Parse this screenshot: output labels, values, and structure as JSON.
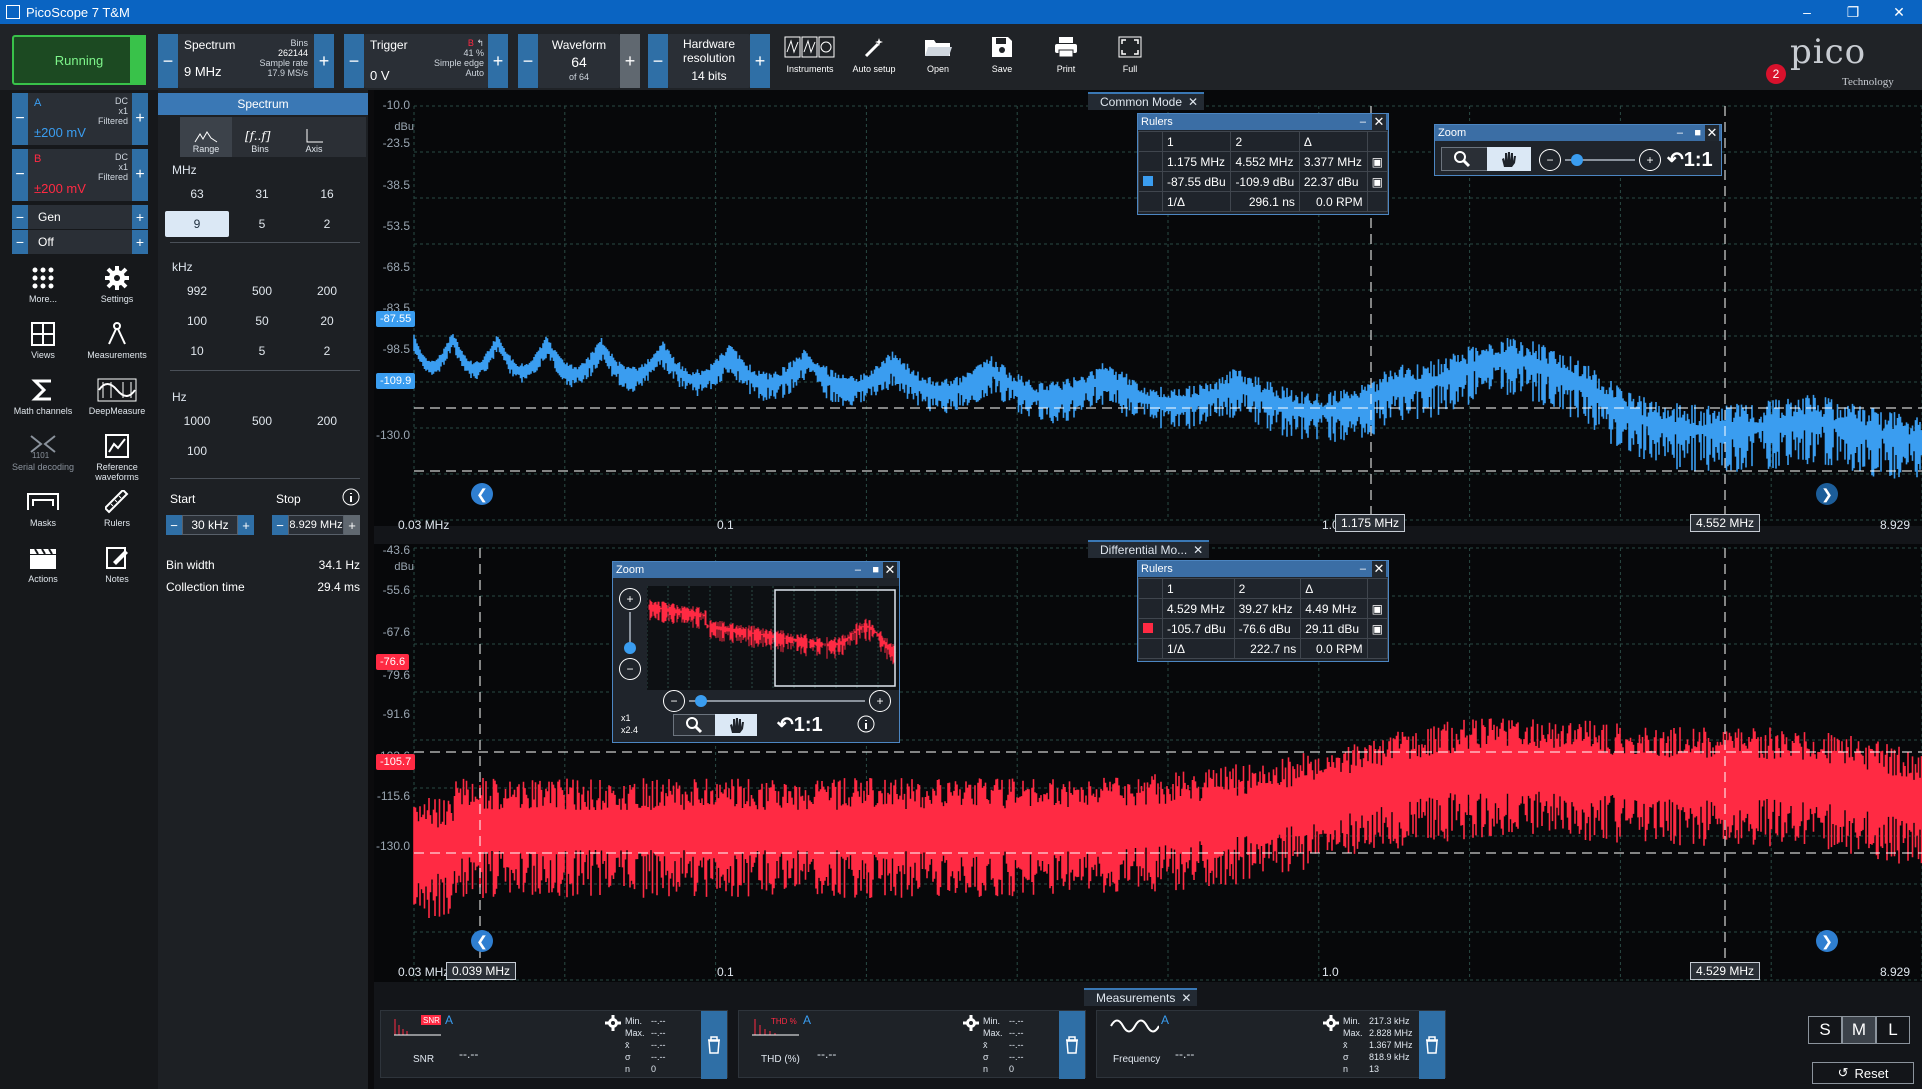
{
  "window": {
    "title": "PicoScope 7 T&M"
  },
  "toolbar": {
    "run_label": "Running",
    "spectrum": {
      "label": "Spectrum",
      "value": "9 MHz",
      "bins_label": "Bins",
      "bins_value": "262144",
      "sample_rate_label": "Sample rate",
      "sample_rate_value": "17.9 MS/s"
    },
    "trigger": {
      "label": "Trigger",
      "value": "0 V",
      "channel": "B",
      "percent": "41 %",
      "type": "Simple edge",
      "mode": "Auto"
    },
    "waveform": {
      "label": "Waveform",
      "value": "64",
      "of": "of 64"
    },
    "hw_res": {
      "label1": "Hardware",
      "label2": "resolution",
      "value": "14 bits"
    },
    "buttons": {
      "instruments": "Instruments",
      "autosetup": "Auto setup",
      "open": "Open",
      "save": "Save",
      "print": "Print",
      "full": "Full"
    },
    "logo_text": "pico",
    "logo_sub": "Technology",
    "notifications": "2"
  },
  "channels": [
    {
      "name": "A",
      "range": "±200 mV",
      "coupling": "DC",
      "probe": "x1",
      "filter": "Filtered",
      "color": "#3a9df0"
    },
    {
      "name": "B",
      "range": "±200 mV",
      "coupling": "DC",
      "probe": "x1",
      "filter": "Filtered",
      "color": "#ff2a43"
    }
  ],
  "gen": {
    "label": "Gen",
    "state": "Off"
  },
  "tools": {
    "more": "More...",
    "settings": "Settings",
    "views": "Views",
    "measurements": "Measurements",
    "math": "Math channels",
    "deep": "DeepMeasure",
    "serial": "Serial decoding",
    "reference": "Reference waveforms",
    "masks": "Masks",
    "rulers": "Rulers",
    "actions": "Actions",
    "notes": "Notes"
  },
  "spectrum_panel": {
    "title": "Spectrum",
    "tabs": [
      "Range",
      "Bins",
      "Axis"
    ],
    "mhz_title": "MHz",
    "mhz": [
      "63",
      "31",
      "16",
      "9",
      "5",
      "2"
    ],
    "khz_title": "kHz",
    "khz": [
      "992",
      "500",
      "200",
      "100",
      "50",
      "20",
      "10",
      "5",
      "2"
    ],
    "hz_title": "Hz",
    "hz": [
      "1000",
      "500",
      "200",
      "100"
    ],
    "start_label": "Start",
    "stop_label": "Stop",
    "start_value": "30 kHz",
    "stop_value": "8.929 MHz",
    "bin_width_label": "Bin width",
    "bin_width": "34.1 Hz",
    "collection_label": "Collection time",
    "collection": "29.4 ms"
  },
  "view1": {
    "tab": "Common Mode",
    "y_unit": "dBu",
    "y_ticks": [
      "-10.0",
      "-23.5",
      "-38.5",
      "-53.5",
      "-68.5",
      "-83.5",
      "-98.5",
      "-130.0"
    ],
    "x_ticks": [
      "0.03 MHz",
      "0.1",
      "1.0",
      "8.929"
    ],
    "ruler_marks": [
      "-87.55",
      "-109.9"
    ],
    "x_marks": [
      "1.175 MHz",
      "4.552 MHz"
    ],
    "rulers": {
      "title": "Rulers",
      "h1": "1",
      "h2": "2",
      "hd": "Δ",
      "r1c1": "1.175 MHz",
      "r1c2": "4.552 MHz",
      "r1cd": "3.377 MHz",
      "r2c1": "-87.55 dBu",
      "r2c2": "-109.9 dBu",
      "r2cd": "22.37 dBu",
      "inv": "1/Δ",
      "inv_val": "296.1 ns",
      "rpm": "0.0 RPM"
    },
    "zoom": {
      "title": "Zoom",
      "ratio": "1:1"
    }
  },
  "view2": {
    "tab": "Differential Mo...",
    "y_unit": "dBu",
    "y_ticks": [
      "-43.6",
      "-55.6",
      "-67.6",
      "-79.6",
      "-91.6",
      "-103.6",
      "-115.6",
      "-130.0"
    ],
    "x_ticks": [
      "0.03 MHz",
      "0.1",
      "1.0",
      "8.929"
    ],
    "ruler_marks": [
      "-76.6",
      "-105.7"
    ],
    "x_marks": [
      "0.039 MHz",
      "4.529 MHz"
    ],
    "rulers": {
      "title": "Rulers",
      "h1": "1",
      "h2": "2",
      "hd": "Δ",
      "r1c1": "4.529 MHz",
      "r1c2": "39.27 kHz",
      "r1cd": "4.49 MHz",
      "r2c1": "-105.7 dBu",
      "r2c2": "-76.6 dBu",
      "r2cd": "29.11 dBu",
      "inv": "1/Δ",
      "inv_val": "222.7 ns",
      "rpm": "0.0 RPM"
    },
    "zoom": {
      "title": "Zoom",
      "ratio": "1:1",
      "x1": "x1",
      "x2": "x2.4"
    }
  },
  "measurements": {
    "tab": "Measurements",
    "cards": [
      {
        "name": "SNR",
        "channel": "A",
        "value": "--.--",
        "min_l": "Min.",
        "max_l": "Max.",
        "mean_l": "x̄",
        "sd_l": "σ",
        "n_l": "n",
        "min": "--.--",
        "max": "--.--",
        "mean": "--.--",
        "sd": "--.--",
        "n": "0"
      },
      {
        "name": "THD (%)",
        "channel": "A",
        "value": "--.--",
        "min_l": "Min.",
        "max_l": "Max.",
        "mean_l": "x̄",
        "sd_l": "σ",
        "n_l": "n",
        "min": "--.--",
        "max": "--.--",
        "mean": "--.--",
        "sd": "--.--",
        "n": "0"
      },
      {
        "name": "Frequency",
        "channel": "A",
        "value": "--.--",
        "min_l": "Min.",
        "max_l": "Max.",
        "mean_l": "x̄",
        "sd_l": "σ",
        "n_l": "n",
        "min": "217.3 kHz",
        "max": "2.828 MHz",
        "mean": "1.367 MHz",
        "sd": "818.9 kHz",
        "n": "13"
      }
    ],
    "sizes": [
      "S",
      "M",
      "L"
    ],
    "reset": "Reset"
  }
}
